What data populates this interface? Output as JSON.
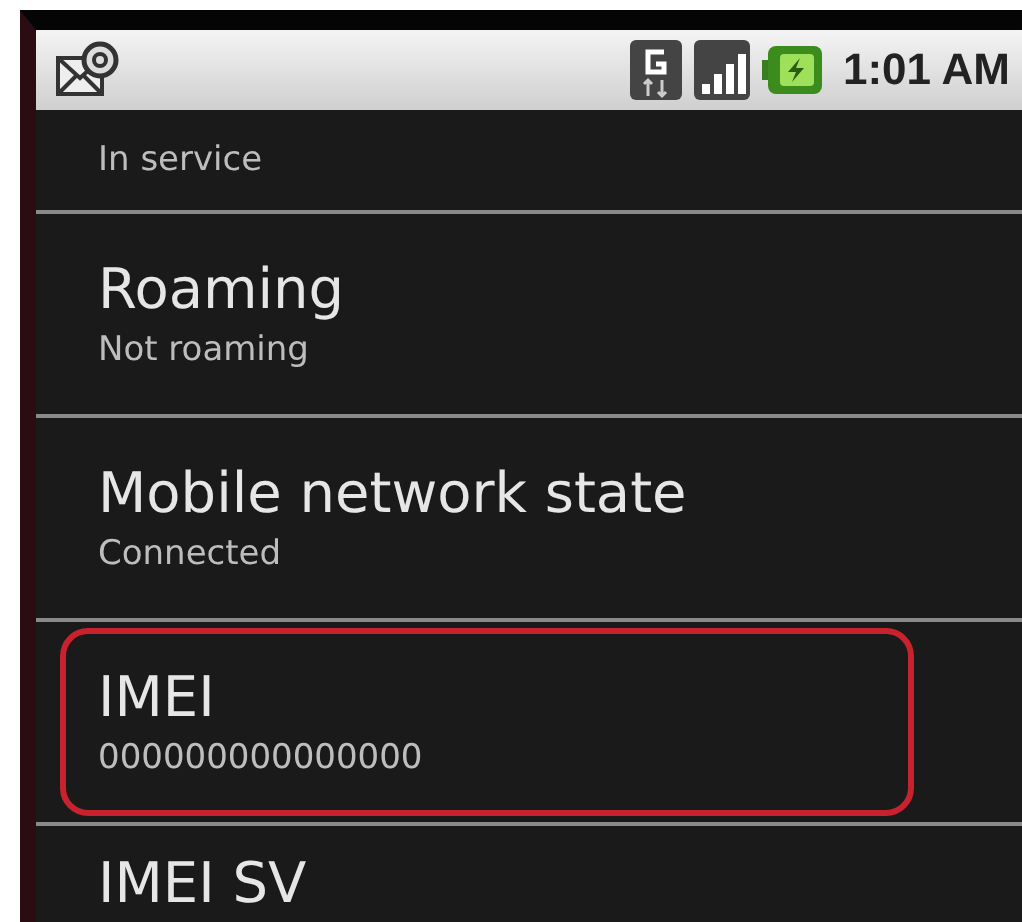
{
  "status_bar": {
    "time": "1:01 AM"
  },
  "items": [
    {
      "kind": "clipped_top",
      "summary": "In service",
      "highlighted": false
    },
    {
      "kind": "full",
      "title": "Roaming",
      "summary": "Not roaming",
      "highlighted": false
    },
    {
      "kind": "full",
      "title": "Mobile network state",
      "summary": "Connected",
      "highlighted": false
    },
    {
      "kind": "full",
      "title": "IMEI",
      "summary": "000000000000000",
      "highlighted": true
    },
    {
      "kind": "clipped_bottom",
      "title": "IMEI SV",
      "highlighted": false
    }
  ]
}
